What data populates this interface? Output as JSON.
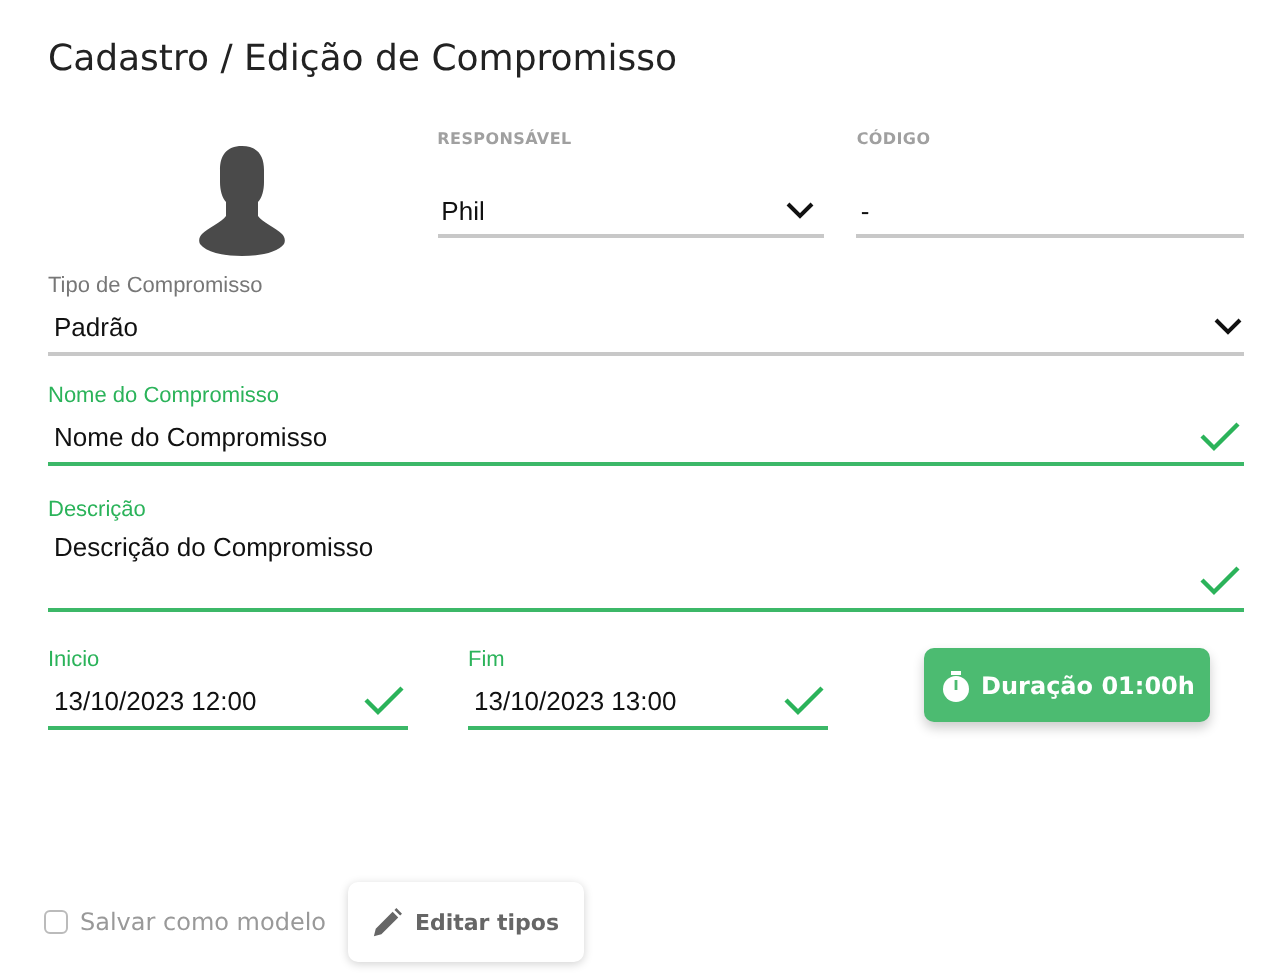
{
  "title": "Cadastro / Edição de Compromisso",
  "responsavel": {
    "label": "RESPONSÁVEL",
    "value": "Phil",
    "kind": "select"
  },
  "codigo": {
    "label": "CÓDIGO",
    "value": "-"
  },
  "fields": [
    {
      "kind": "select",
      "label": "Tipo de Compromisso",
      "value": "Padrão",
      "valid": false
    },
    {
      "kind": "text",
      "label": "Nome do Compromisso",
      "value": "Nome do Compromisso",
      "valid": true
    },
    {
      "kind": "textarea",
      "label": "Descrição",
      "value": "Descrição do Compromisso",
      "valid": true
    }
  ],
  "dates": [
    {
      "label": "Inicio",
      "value": "13/10/2023 12:00",
      "valid": true
    },
    {
      "label": "Fim",
      "value": "13/10/2023 13:00",
      "valid": true
    }
  ],
  "duration_button": "Duração 01:00h",
  "save_as_template": {
    "label": "Salvar como modelo",
    "checked": false
  },
  "edit_types_button": "Editar tipos"
}
